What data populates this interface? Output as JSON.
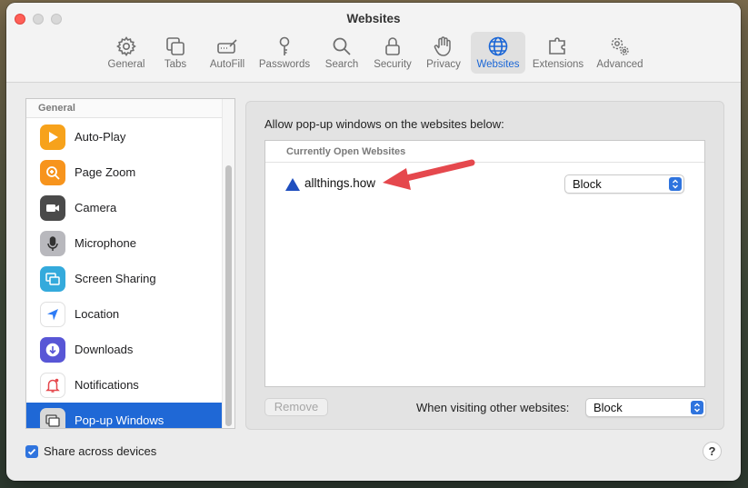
{
  "window": {
    "title": "Websites"
  },
  "toolbar": {
    "items": [
      {
        "label": "General",
        "icon": "gear-icon"
      },
      {
        "label": "Tabs",
        "icon": "tabs-icon"
      },
      {
        "label": "AutoFill",
        "icon": "autofill-icon"
      },
      {
        "label": "Passwords",
        "icon": "key-icon"
      },
      {
        "label": "Search",
        "icon": "search-icon"
      },
      {
        "label": "Security",
        "icon": "lock-icon"
      },
      {
        "label": "Privacy",
        "icon": "hand-icon"
      },
      {
        "label": "Websites",
        "icon": "globe-icon",
        "active": true
      },
      {
        "label": "Extensions",
        "icon": "puzzle-icon"
      },
      {
        "label": "Advanced",
        "icon": "gears-icon"
      }
    ]
  },
  "sidebar": {
    "section": "General",
    "items": [
      {
        "label": "Auto-Play",
        "icon": "play-icon",
        "color": "#f7a21b"
      },
      {
        "label": "Page Zoom",
        "icon": "zoom-icon",
        "color": "#f7941d"
      },
      {
        "label": "Camera",
        "icon": "camera-icon",
        "color": "#4a4a4a"
      },
      {
        "label": "Microphone",
        "icon": "microphone-icon",
        "color": "#8e8e93"
      },
      {
        "label": "Screen Sharing",
        "icon": "screen-sharing-icon",
        "color": "#34aadc"
      },
      {
        "label": "Location",
        "icon": "location-icon",
        "color": "#2e7cf6"
      },
      {
        "label": "Downloads",
        "icon": "download-icon",
        "color": "#5856d6"
      },
      {
        "label": "Notifications",
        "icon": "bell-icon",
        "color": "#ffffff"
      },
      {
        "label": "Pop-up Windows",
        "icon": "popup-icon",
        "color": "#d8d8d8",
        "selected": true
      }
    ]
  },
  "panel": {
    "heading": "Allow pop-up windows on the websites below:",
    "table_header": "Currently Open Websites",
    "sites": [
      {
        "name": "allthings.how",
        "setting": "Block"
      }
    ],
    "remove_label": "Remove",
    "other_label": "When visiting other websites:",
    "other_value": "Block"
  },
  "footer": {
    "share_label": "Share across devices",
    "share_checked": true,
    "help_label": "?"
  },
  "colors": {
    "accent": "#1f68d6",
    "annotation_arrow": "#e5484d"
  }
}
